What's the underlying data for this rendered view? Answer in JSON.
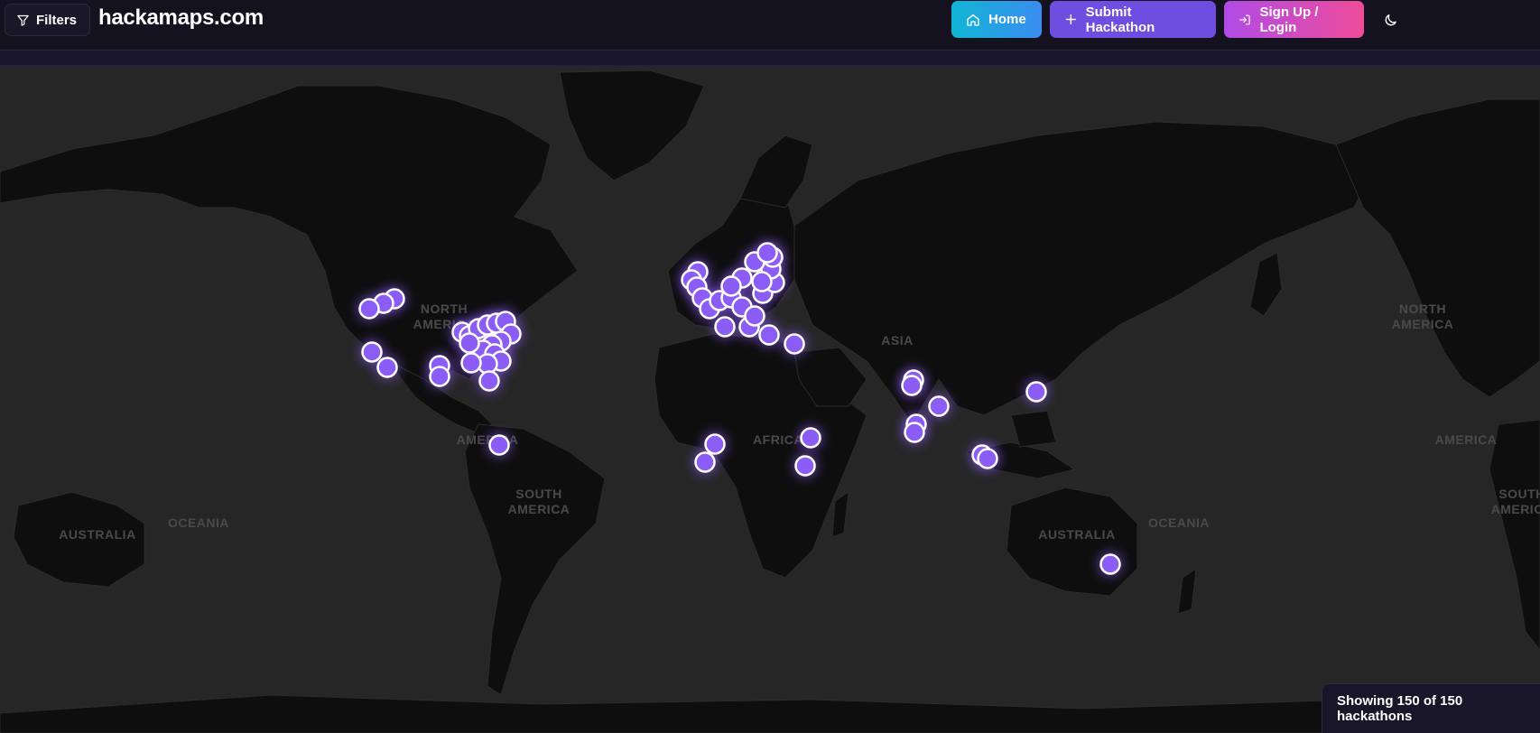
{
  "header": {
    "filters_label": "Filters",
    "brand": "hackamaps.com",
    "home_label": "Home",
    "submit_label": "Submit Hackathon",
    "login_label": "Sign Up / Login",
    "theme_icon": "moon-icon"
  },
  "map": {
    "labels": {
      "north_america_left": [
        "NORTH",
        "AMERICA"
      ],
      "central_america_left": "AMERICA",
      "south_america_left": [
        "SOUTH",
        "AMERICA"
      ],
      "australia_left": "AUSTRALIA",
      "oceania_left": "OCEANIA",
      "asia": "ASIA",
      "africa": "AFRICA",
      "north_america_right": [
        "NORTH",
        "AMERICA"
      ],
      "central_america_right": "AMERICA",
      "south_america_right": [
        "SOUTH",
        "AMERICA"
      ],
      "australia_right": "AUSTRALIA",
      "oceania_right": "OCEANIA"
    },
    "marker_color": "#8b5cf6",
    "marker_border": "#ffffff",
    "land_color": "#0e0e0e",
    "water_color": "#262626"
  },
  "status": {
    "text": "Showing 150 of 150 hackathons",
    "shown": 150,
    "total": 150
  }
}
